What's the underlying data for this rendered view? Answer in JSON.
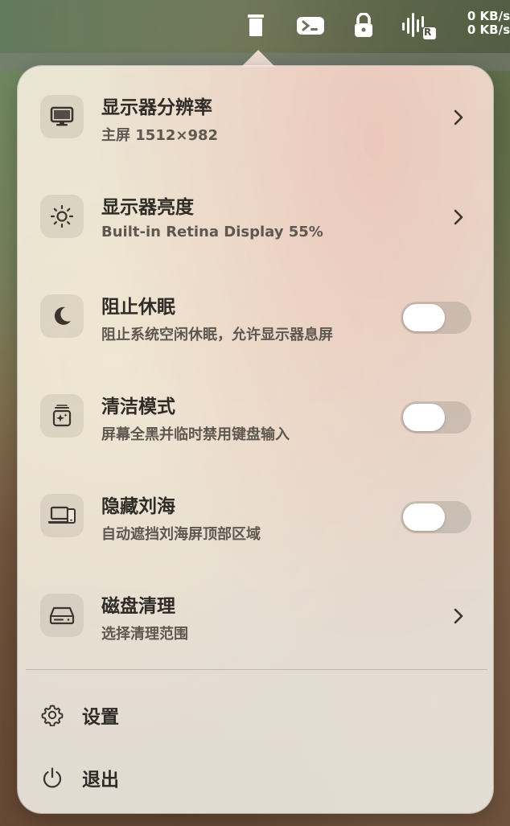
{
  "menubar": {
    "icons": [
      "notch-icon",
      "terminal-icon",
      "lock-icon",
      "audio-bars-icon"
    ],
    "audio_badge": "R",
    "net_up": "0 KB/s",
    "net_down": "0 KB/s"
  },
  "rows": [
    {
      "title": "显示器分辨率",
      "subtitle": "主屏 1512×982",
      "icon": "display-icon",
      "control": "chevron"
    },
    {
      "title": "显示器亮度",
      "subtitle": "Built-in Retina Display 55%",
      "icon": "sun-icon",
      "control": "chevron"
    },
    {
      "title": "阻止休眠",
      "subtitle": "阻止系统空闲休眠，允许显示器息屏",
      "icon": "moon-icon",
      "control": "toggle",
      "on": false
    },
    {
      "title": "清洁模式",
      "subtitle": "屏幕全黑并临时禁用键盘输入",
      "icon": "clean-icon",
      "control": "toggle",
      "on": false
    },
    {
      "title": "隐藏刘海",
      "subtitle": "自动遮挡刘海屏顶部区域",
      "icon": "laptop-phone-icon",
      "control": "toggle",
      "on": false
    },
    {
      "title": "磁盘清理",
      "subtitle": "选择清理范围",
      "icon": "disk-icon",
      "control": "chevron"
    }
  ],
  "footer": {
    "settings_label": "设置",
    "quit_label": "退出"
  }
}
